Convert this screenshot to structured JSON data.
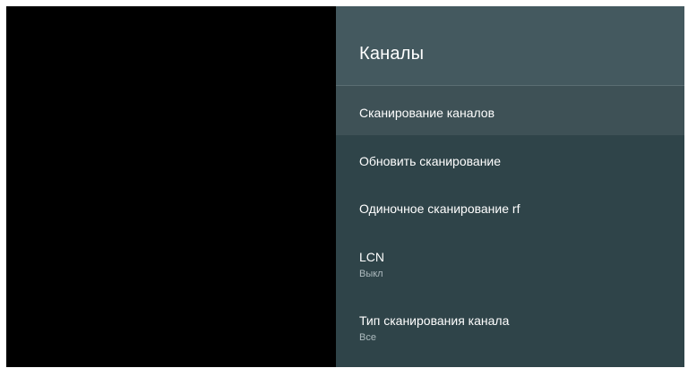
{
  "panel": {
    "title": "Каналы",
    "items": [
      {
        "label": "Сканирование каналов",
        "value": ""
      },
      {
        "label": "Обновить сканирование",
        "value": ""
      },
      {
        "label": "Одиночное сканирование rf",
        "value": ""
      },
      {
        "label": "LCN",
        "value": "Выкл"
      },
      {
        "label": "Тип сканирования канала",
        "value": "Все"
      }
    ]
  },
  "colors": {
    "panel_background": "#2f4449",
    "header_background": "#44595f",
    "focused_item": "#3e5156",
    "video_background": "#000000"
  }
}
